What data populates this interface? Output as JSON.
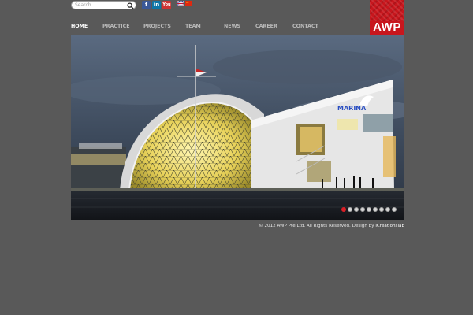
{
  "header": {
    "search": {
      "placeholder": "Search",
      "value": ""
    },
    "socials": [
      {
        "name": "facebook",
        "glyph": "f",
        "color": "#3b5998"
      },
      {
        "name": "linkedin",
        "glyph": "in",
        "color": "#0e76a8"
      },
      {
        "name": "youtube",
        "glyph": "You",
        "color": "#cc3333"
      }
    ],
    "languages": [
      "english",
      "chinese"
    ],
    "logo": {
      "text": "AWP",
      "color": "#c8161d"
    }
  },
  "nav": {
    "items": [
      {
        "label": "HOME",
        "active": true
      },
      {
        "label": "PRACTICE",
        "active": false
      },
      {
        "label": "PROJECTS",
        "active": false
      },
      {
        "label": "TEAM",
        "active": false
      },
      {
        "label": "NEWS",
        "active": false
      },
      {
        "label": "CAREER",
        "active": false
      },
      {
        "label": "CONTACT",
        "active": false
      }
    ]
  },
  "hero": {
    "sign_text": "MARINA",
    "slide_count": 9,
    "active_slide": 1,
    "accent_color": "#d81f26"
  },
  "footer": {
    "text": "© 2012 AWP Pte Ltd. All Rights Reserved. Design by ",
    "link": "iCreationslab"
  }
}
